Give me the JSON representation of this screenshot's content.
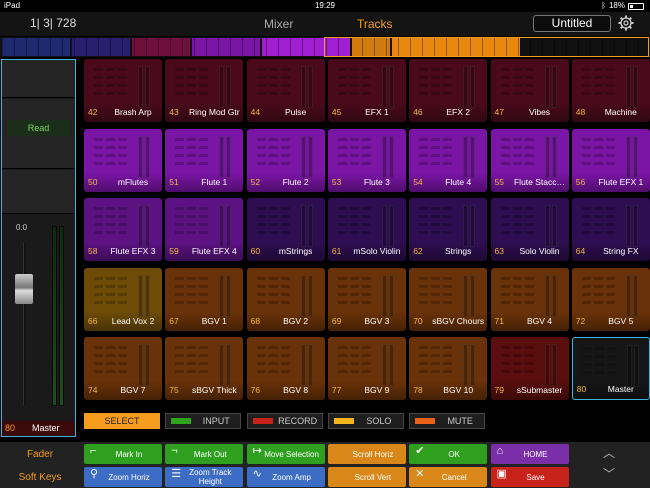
{
  "status": {
    "device": "iPad",
    "time": "19:29",
    "battery": "18%",
    "battery_level": 0.18
  },
  "header": {
    "position": "1| 3| 728",
    "tabs": [
      "Mixer",
      "Tracks"
    ],
    "active_tab": "Tracks",
    "title": "Untitled",
    "settings_icon": "gear-icon"
  },
  "strip": {
    "automation": "Read",
    "gain": "0.0",
    "number": "80",
    "name": "Master"
  },
  "tracks": [
    {
      "n": "42",
      "name": "Brash Arp",
      "color": "#4a0a1c"
    },
    {
      "n": "43",
      "name": "Ring Mod Gtr",
      "color": "#4a0a1c"
    },
    {
      "n": "44",
      "name": "Pulse",
      "color": "#4a0a1c"
    },
    {
      "n": "45",
      "name": "EFX 1",
      "color": "#4a0a1c"
    },
    {
      "n": "46",
      "name": "EFX 2",
      "color": "#4a0a1c"
    },
    {
      "n": "47",
      "name": "Vibes",
      "color": "#4a0a1c"
    },
    {
      "n": "48",
      "name": "Machine",
      "color": "#4a0a1c"
    },
    {
      "n": "50",
      "name": "mFlutes",
      "color": "#7a15a6"
    },
    {
      "n": "51",
      "name": "Flute 1",
      "color": "#7a15a6"
    },
    {
      "n": "52",
      "name": "Flute 2",
      "color": "#7a15a6"
    },
    {
      "n": "53",
      "name": "Flute 3",
      "color": "#7a15a6"
    },
    {
      "n": "54",
      "name": "Flute 4",
      "color": "#7a15a6"
    },
    {
      "n": "55",
      "name": "Flute Stacc…",
      "color": "#7a15a6"
    },
    {
      "n": "56",
      "name": "Flute EFX 1",
      "color": "#7a15a6"
    },
    {
      "n": "58",
      "name": "Flute EFX 3",
      "color": "#5c1283"
    },
    {
      "n": "59",
      "name": "Flute EFX 4",
      "color": "#5c1283"
    },
    {
      "n": "60",
      "name": "mStrings",
      "color": "#2e0e50"
    },
    {
      "n": "61",
      "name": "mSolo Violin",
      "color": "#2e0e50"
    },
    {
      "n": "62",
      "name": "Strings",
      "color": "#2e0e50"
    },
    {
      "n": "63",
      "name": "Solo Violin",
      "color": "#2e0e50"
    },
    {
      "n": "64",
      "name": "String FX",
      "color": "#2e0e50"
    },
    {
      "n": "66",
      "name": "Lead Vox 2",
      "color": "#6e4c08"
    },
    {
      "n": "67",
      "name": "BGV 1",
      "color": "#6a3208"
    },
    {
      "n": "68",
      "name": "BGV 2",
      "color": "#6a3208"
    },
    {
      "n": "69",
      "name": "BGV 3",
      "color": "#6a3208"
    },
    {
      "n": "70",
      "name": "sBGV Chours",
      "color": "#6a3208"
    },
    {
      "n": "71",
      "name": "BGV 4",
      "color": "#6a3208"
    },
    {
      "n": "72",
      "name": "BGV 5",
      "color": "#6a3208"
    },
    {
      "n": "74",
      "name": "BGV 7",
      "color": "#6a3208"
    },
    {
      "n": "75",
      "name": "sBGV Thick",
      "color": "#6a3208"
    },
    {
      "n": "76",
      "name": "BGV 8",
      "color": "#6a3208"
    },
    {
      "n": "77",
      "name": "BGV 9",
      "color": "#6a3208"
    },
    {
      "n": "78",
      "name": "BGV 10",
      "color": "#6a3208"
    },
    {
      "n": "79",
      "name": "sSubmaster",
      "color": "#5a0e0e"
    },
    {
      "n": "80",
      "name": "Master",
      "color": "#161616",
      "selected": true
    }
  ],
  "modes": [
    {
      "label": "SELECT",
      "swatch": "",
      "active": true
    },
    {
      "label": "INPUT",
      "swatch": "#2fa51c"
    },
    {
      "label": "RECORD",
      "swatch": "#c8231b"
    },
    {
      "label": "SOLO",
      "swatch": "#f2b51c"
    },
    {
      "label": "MUTE",
      "swatch": "#e8621c"
    }
  ],
  "bottom": {
    "fader_label": "Fader",
    "softkeys_label": "Soft Keys",
    "buttons": [
      {
        "label": "Mark In",
        "color": "green",
        "icon": "mark-in-icon",
        "glyph": "⌐"
      },
      {
        "label": "Mark Out",
        "color": "green",
        "icon": "mark-out-icon",
        "glyph": "¬"
      },
      {
        "label": "Move Selection",
        "color": "green",
        "icon": "move-selection-icon",
        "glyph": "↦"
      },
      {
        "label": "Scroll Horiz",
        "color": "orange",
        "icon": "",
        "glyph": ""
      },
      {
        "label": "OK",
        "color": "green",
        "icon": "check-icon",
        "glyph": "✔"
      },
      {
        "label": "HOME",
        "color": "purple",
        "icon": "home-icon",
        "glyph": "⌂"
      },
      {
        "label": "Zoom Horiz",
        "color": "blue",
        "icon": "magnifier-icon",
        "glyph": "⚲"
      },
      {
        "label": "Zoom Track Height",
        "color": "blue",
        "icon": "track-height-icon",
        "glyph": "☰"
      },
      {
        "label": "Zoom Amp",
        "color": "blue",
        "icon": "waveform-icon",
        "glyph": "∿"
      },
      {
        "label": "Scroll Vert",
        "color": "orange",
        "icon": "",
        "glyph": ""
      },
      {
        "label": "Cancel",
        "color": "orange",
        "icon": "cancel-icon",
        "glyph": "✕"
      },
      {
        "label": "Save",
        "color": "red",
        "icon": "save-icon",
        "glyph": "▣"
      }
    ]
  },
  "overview_colors": [
    "#1f2a6e",
    "#2a1f6e",
    "#6e0f3c",
    "#7a15a6",
    "#a01fd0",
    "#d07a10",
    "#e8880f"
  ]
}
